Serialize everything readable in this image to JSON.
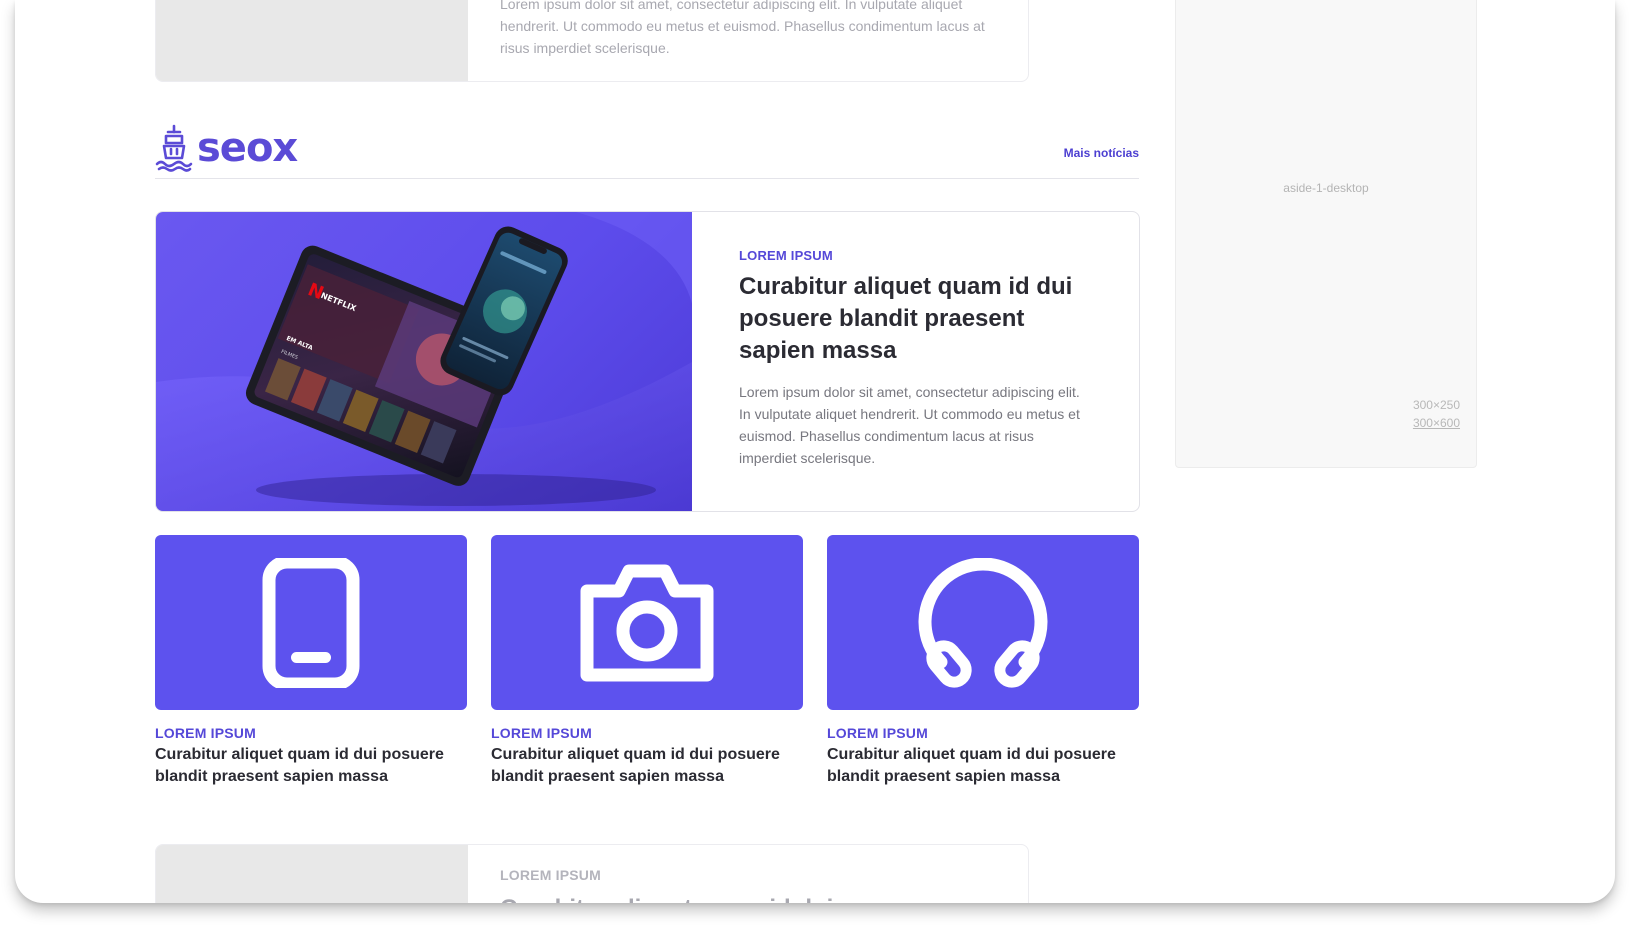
{
  "top_card": {
    "text": "Lorem ipsum dolor sit amet, consectetur adipiscing elit. In vulputate aliquet hendrerit. Ut commodo eu metus et euismod. Phasellus condimentum lacus at risus imperdiet scelerisque."
  },
  "section": {
    "brand": "seox",
    "more_link": "Mais notícias"
  },
  "featured": {
    "kicker": "LOREM IPSUM",
    "title": "Curabitur aliquet quam id dui posuere blandit praesent sapien massa",
    "description": "Lorem ipsum dolor sit amet, consectetur adipiscing elit. In vulputate aliquet hendrerit. Ut commodo eu metus et euismod. Phasellus condimentum lacus at risus imperdiet scelerisque.",
    "image": {
      "tablet_brand": "NETFLIX",
      "tablet_row": "EM ALTA",
      "tablet_sub": "FILMES"
    }
  },
  "mini_cards": [
    {
      "icon": "smartphone-icon",
      "kicker": "LOREM IPSUM",
      "title": "Curabitur aliquet quam id dui posuere blandit praesent sapien massa"
    },
    {
      "icon": "camera-icon",
      "kicker": "LOREM IPSUM",
      "title": "Curabitur aliquet quam id dui posuere blandit praesent sapien massa"
    },
    {
      "icon": "headphones-icon",
      "kicker": "LOREM IPSUM",
      "title": "Curabitur aliquet quam id dui posuere blandit praesent sapien massa"
    }
  ],
  "bottom_card": {
    "kicker": "LOREM IPSUM",
    "title": "Curabitur aliquet quam id dui posuere"
  },
  "aside_ad": {
    "label": "aside-1-desktop",
    "size_primary": "300×250",
    "size_alt": "300×600"
  },
  "colors": {
    "accent": "#5b4bd6",
    "tile": "#5d52ee",
    "text_dark": "#2b2b33",
    "text_muted": "#77777f"
  }
}
